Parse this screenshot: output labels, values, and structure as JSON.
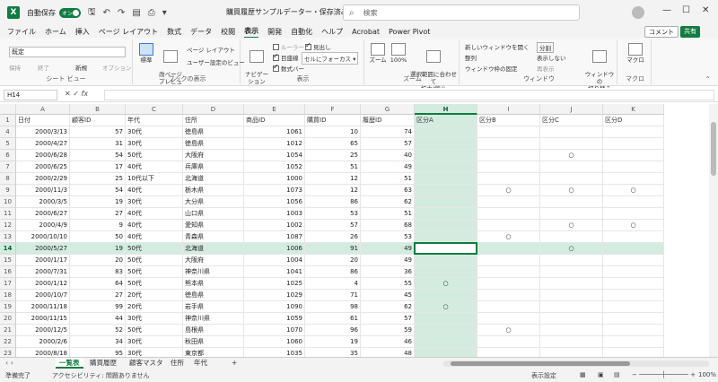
{
  "titlebar": {
    "autosave_label": "自動保存",
    "autosave_state": "オン",
    "doc_title": "購買履歴サンプルデーター・保存済み",
    "search_placeholder": "検索"
  },
  "ribbon_tabs": [
    "ファイル",
    "ホーム",
    "挿入",
    "ページ レイアウト",
    "数式",
    "データ",
    "校閲",
    "表示",
    "開発",
    "自動化",
    "ヘルプ",
    "Acrobat",
    "Power Pivot"
  ],
  "active_tab": "表示",
  "comment_label": "コメント",
  "share_label": "共有",
  "ribbon": {
    "sheet_view": {
      "select_value": "既定",
      "keep": "保持",
      "exit": "終了",
      "new": "新規",
      "options": "オプション",
      "label": "シート ビュー"
    },
    "workbook_view": {
      "normal": "標準",
      "page_break": "改ページ\nプレビュー",
      "page_layout": "ページ レイアウト",
      "custom": "ユーザー設定のビュー",
      "label": "ブックの表示"
    },
    "show": {
      "navigation": "ナビゲー\nション",
      "ruler": "ルーラー",
      "gridlines": "目盛線",
      "formula_bar": "数式バー",
      "headings": "見出し",
      "focus_cell": "セルにフォーカス",
      "label": "表示"
    },
    "zoom": {
      "zoom": "ズーム",
      "hundred": "100%",
      "fit": "選択範囲に合わせて\n拡大/縮小",
      "label": "ズーム"
    },
    "window": {
      "new_window": "新しいウィンドウを開く",
      "arrange": "整列",
      "freeze": "ウィンドウ枠の固定",
      "split": "分割",
      "hide": "表示しない",
      "unhide": "再表示",
      "switch": "ウィンドウの\n切り替え",
      "label": "ウィンドウ"
    },
    "macro": {
      "macro": "マクロ",
      "label": "マクロ"
    }
  },
  "formula_bar": {
    "name_box": "H14",
    "formula": ""
  },
  "columns": [
    "A",
    "B",
    "C",
    "D",
    "E",
    "F",
    "G",
    "H",
    "I",
    "J",
    "K"
  ],
  "selected_column": "H",
  "header_row": {
    "num": "1",
    "cells": [
      "日付",
      "顧客ID",
      "年代",
      "住所",
      "商品ID",
      "購買ID",
      "履歴ID",
      "区分A",
      "区分B",
      "区分C",
      "区分D"
    ]
  },
  "rows": [
    {
      "num": "4",
      "cells": [
        "2000/3/13",
        "57",
        "30代",
        "徳島県",
        "1061",
        "10",
        "74",
        "",
        "",
        "",
        ""
      ]
    },
    {
      "num": "5",
      "cells": [
        "2000/4/27",
        "31",
        "30代",
        "徳島県",
        "1012",
        "65",
        "57",
        "",
        "",
        "",
        ""
      ]
    },
    {
      "num": "6",
      "cells": [
        "2000/6/28",
        "54",
        "50代",
        "大阪府",
        "1054",
        "25",
        "40",
        "",
        "",
        "○",
        ""
      ]
    },
    {
      "num": "7",
      "cells": [
        "2000/6/25",
        "17",
        "40代",
        "兵庫県",
        "1052",
        "51",
        "49",
        "",
        "",
        "",
        ""
      ]
    },
    {
      "num": "8",
      "cells": [
        "2000/2/29",
        "25",
        "10代以下",
        "北海道",
        "1000",
        "12",
        "51",
        "",
        "",
        "",
        ""
      ]
    },
    {
      "num": "9",
      "cells": [
        "2000/11/3",
        "54",
        "40代",
        "栃木県",
        "1073",
        "12",
        "63",
        "",
        "○",
        "○",
        "○"
      ]
    },
    {
      "num": "10",
      "cells": [
        "2000/3/5",
        "19",
        "30代",
        "大分県",
        "1056",
        "86",
        "62",
        "",
        "",
        "",
        ""
      ]
    },
    {
      "num": "11",
      "cells": [
        "2000/6/27",
        "27",
        "40代",
        "山口県",
        "1003",
        "53",
        "51",
        "",
        "",
        "",
        ""
      ]
    },
    {
      "num": "12",
      "cells": [
        "2000/4/9",
        "9",
        "40代",
        "愛知県",
        "1002",
        "57",
        "68",
        "",
        "",
        "○",
        "○"
      ]
    },
    {
      "num": "13",
      "cells": [
        "2000/10/10",
        "50",
        "40代",
        "青森県",
        "1087",
        "26",
        "53",
        "",
        "○",
        "",
        ""
      ]
    },
    {
      "num": "14",
      "cells": [
        "2000/5/27",
        "19",
        "50代",
        "北海道",
        "1006",
        "91",
        "49",
        "",
        "",
        "○",
        ""
      ]
    },
    {
      "num": "15",
      "cells": [
        "2000/1/17",
        "20",
        "50代",
        "大阪府",
        "1004",
        "20",
        "49",
        "",
        "",
        "",
        ""
      ]
    },
    {
      "num": "16",
      "cells": [
        "2000/7/31",
        "83",
        "50代",
        "神奈川県",
        "1041",
        "86",
        "36",
        "",
        "",
        "",
        ""
      ]
    },
    {
      "num": "17",
      "cells": [
        "2000/1/12",
        "64",
        "50代",
        "熊本県",
        "1025",
        "4",
        "55",
        "○",
        "",
        "",
        ""
      ]
    },
    {
      "num": "18",
      "cells": [
        "2000/10/7",
        "27",
        "20代",
        "徳島県",
        "1029",
        "71",
        "45",
        "",
        "",
        "",
        ""
      ]
    },
    {
      "num": "19",
      "cells": [
        "2000/11/18",
        "99",
        "20代",
        "岩手県",
        "1090",
        "98",
        "62",
        "○",
        "",
        "",
        ""
      ]
    },
    {
      "num": "20",
      "cells": [
        "2000/11/15",
        "44",
        "30代",
        "神奈川県",
        "1059",
        "61",
        "57",
        "",
        "",
        "",
        ""
      ]
    },
    {
      "num": "21",
      "cells": [
        "2000/12/5",
        "52",
        "50代",
        "島根県",
        "1070",
        "96",
        "59",
        "",
        "○",
        "",
        ""
      ]
    },
    {
      "num": "22",
      "cells": [
        "2000/2/6",
        "34",
        "30代",
        "秋田県",
        "1060",
        "19",
        "46",
        "",
        "",
        "",
        ""
      ]
    },
    {
      "num": "23",
      "cells": [
        "2000/8/18",
        "95",
        "30代",
        "東京都",
        "1035",
        "35",
        "48",
        "",
        "",
        "",
        ""
      ]
    },
    {
      "num": "24",
      "cells": [
        "2000/6/10",
        "20",
        "40代",
        "長崎県",
        "1012",
        "52",
        "55",
        "",
        "",
        "",
        ""
      ]
    }
  ],
  "selected_row": "14",
  "sheet_tabs": [
    "一覧表",
    "購買履歴",
    "顧客マスタ",
    "住所",
    "年代"
  ],
  "active_sheet": "一覧表",
  "status": {
    "ready": "準備完了",
    "accessibility": "アクセシビリティ: 問題ありません",
    "display_settings": "表示設定",
    "zoom": "100%"
  },
  "colors": {
    "accent": "#107c41",
    "selection": "#d3ecdf"
  }
}
